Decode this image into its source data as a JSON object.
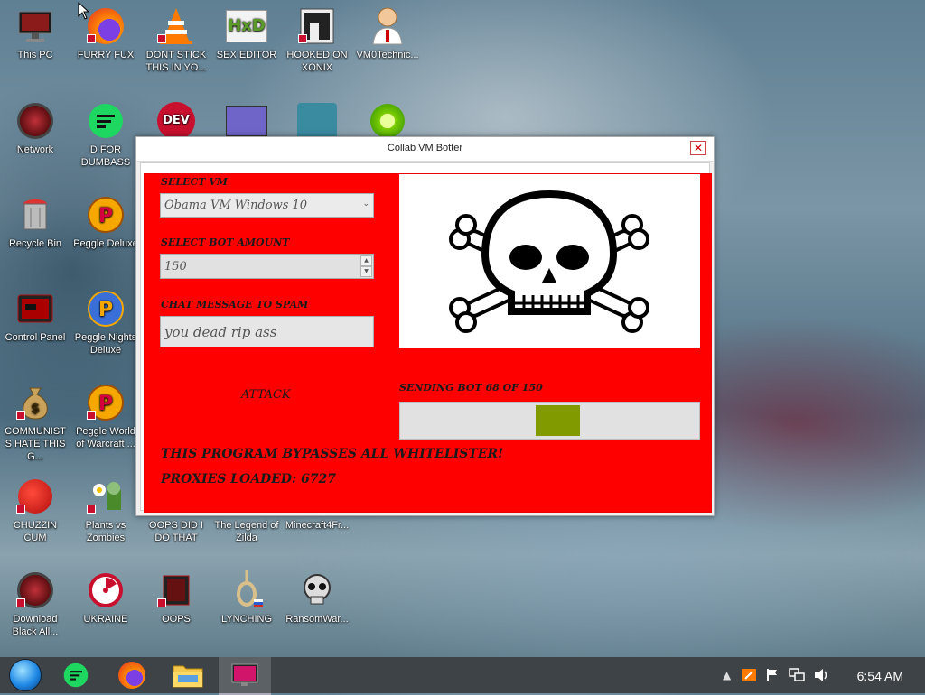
{
  "desktop": {
    "icons": [
      {
        "label": "This PC"
      },
      {
        "label": "FURRY FUX"
      },
      {
        "label": "DONT STICK THIS IN YO..."
      },
      {
        "label": "SEX EDITOR"
      },
      {
        "label": "HOOKED ON XONIX"
      },
      {
        "label": "VM0Technic..."
      },
      {
        "label": "Network"
      },
      {
        "label": "D FOR DUMBASS"
      },
      {
        "label": "Recycle Bin"
      },
      {
        "label": "Peggle Deluxe"
      },
      {
        "label": "Control Panel"
      },
      {
        "label": "Peggle Nights Deluxe"
      },
      {
        "label": "COMMUNISTS HATE THIS G..."
      },
      {
        "label": "Peggle World of Warcraft ..."
      },
      {
        "label": "CHUZZIN CUM"
      },
      {
        "label": "Plants vs Zombies"
      },
      {
        "label": "OOPS DID I DO THAT"
      },
      {
        "label": "The Legend of Zilda"
      },
      {
        "label": "Minecraft4Fr..."
      },
      {
        "label": "Download Black All..."
      },
      {
        "label": "UKRAINE"
      },
      {
        "label": "OOPS"
      },
      {
        "label": "LYNCHING"
      },
      {
        "label": "RansomWar..."
      }
    ],
    "row2_partial_icons": [
      "dev-cpp-icon",
      "app-window-icon",
      "santa-icon",
      "lime-icon"
    ]
  },
  "window": {
    "title": "Collab VM Botter",
    "close_glyph": "✕",
    "select_vm_label": "SELECT VM",
    "select_vm_value": "Obama VM Windows 10",
    "bot_amount_label": "SELECT BOT AMOUNT",
    "bot_amount_value": "150",
    "chat_label": "CHAT MESSAGE TO SPAM",
    "chat_value": "you dead rip ass",
    "attack_label": "ATTACK",
    "sending_label": "SENDING BOT 68 OF 150",
    "progress_fraction": 0.453,
    "bypass_text": "THIS PROGRAM BYPASSES ALL WHITELISTER!",
    "proxies_text": "PROXIES LOADED: 6727",
    "image_icon": "skull-crossbones-icon",
    "panel_color": "#fe0000",
    "progress_color": "#809a00"
  },
  "taskbar": {
    "items": [
      "start-orb-icon",
      "d-for-dumbass-icon",
      "firefox-icon",
      "file-explorer-icon",
      "collab-vm-botter-icon"
    ],
    "tray_icons": [
      "chevron-up-icon",
      "flag-icon",
      "network-icon",
      "volume-icon"
    ],
    "clock": "6:54 AM"
  }
}
